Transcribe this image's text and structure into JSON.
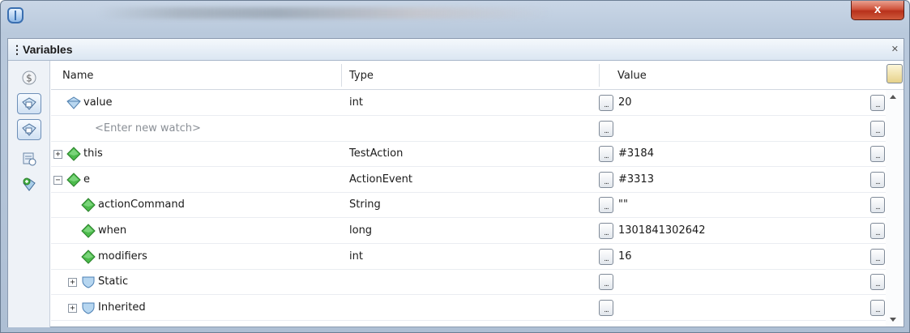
{
  "panel": {
    "title": "Variables",
    "close_symbol": "✕"
  },
  "window": {
    "close_symbol": "x"
  },
  "columns": {
    "name": "Name",
    "type": "Type",
    "value": "Value"
  },
  "ellipsis": "...",
  "rows": [
    {
      "name": "value",
      "type": "int",
      "value": "20",
      "expander": "",
      "icon": "watch-icon",
      "indent": 0
    },
    {
      "name": "<Enter new watch>",
      "type": "",
      "value": "",
      "expander": "",
      "icon": "",
      "indent": 0,
      "placeholder": true
    },
    {
      "name": "this",
      "type": "TestAction",
      "value": "#3184",
      "expander": "+",
      "icon": "field-icon",
      "indent": 0
    },
    {
      "name": "e",
      "type": "ActionEvent",
      "value": "#3313",
      "expander": "−",
      "icon": "field-icon",
      "indent": 0
    },
    {
      "name": "actionCommand",
      "type": "String",
      "value": "\"\"",
      "expander": "",
      "icon": "field-icon",
      "indent": 1
    },
    {
      "name": "when",
      "type": "long",
      "value": "1301841302642",
      "expander": "",
      "icon": "field-icon",
      "indent": 1
    },
    {
      "name": "modifiers",
      "type": "int",
      "value": "16",
      "expander": "",
      "icon": "field-icon",
      "indent": 1
    },
    {
      "name": "Static",
      "type": "",
      "value": "",
      "expander": "+",
      "icon": "shield-icon",
      "indent": 1
    },
    {
      "name": "Inherited",
      "type": "",
      "value": "",
      "expander": "+",
      "icon": "shield-icon",
      "indent": 1
    }
  ],
  "toolbar": [
    "static-dollar-icon",
    "watch-toggle-icon",
    "watch-add-icon",
    "evaluate-icon",
    "new-watch-icon"
  ],
  "colors": {
    "field_green": "#3fae3f",
    "watch_blue": "#6fa6d8",
    "close_red": "#c8412a"
  }
}
